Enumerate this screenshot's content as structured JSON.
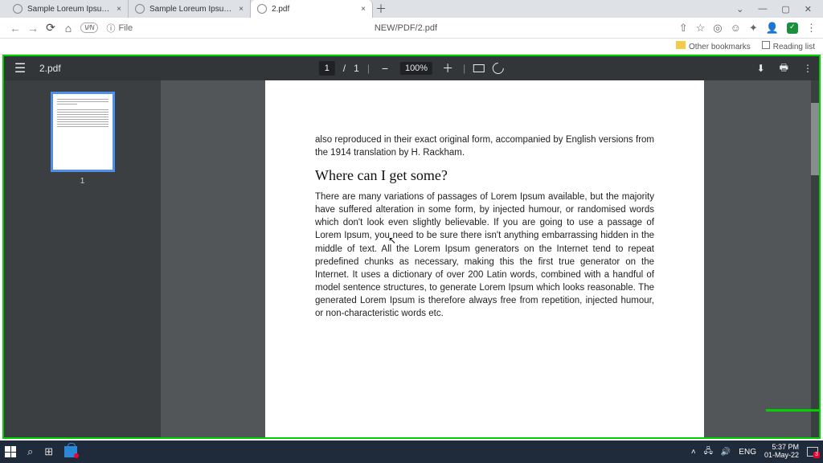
{
  "browser": {
    "tabs": [
      {
        "title": "Sample Loreum Ipsum.pdf",
        "active": false
      },
      {
        "title": "Sample Loreum Ipsum.pdf",
        "active": false
      },
      {
        "title": "2.pdf",
        "active": true
      }
    ],
    "new_tab": "＋",
    "window": {
      "min": "—",
      "max": "▢",
      "close": "✕",
      "down": "⌄"
    },
    "nav": {
      "back": "←",
      "forward": "→",
      "reload": "⟳",
      "home": "⌂"
    },
    "vpn": "V⁄N",
    "url_proto_icon": "ⓘ",
    "url_left": "File",
    "url_center": "NEW/PDF/2.pdf",
    "icons": {
      "share": "⇧",
      "star": "☆",
      "g": "◎",
      "smile": "☺",
      "puzzle": "✦",
      "user": "👤",
      "menu": "⋮"
    }
  },
  "bookmarks": {
    "other": "Other bookmarks",
    "reading": "Reading list"
  },
  "viewer": {
    "menu": "☰",
    "title": "2.pdf",
    "page_current": "1",
    "page_sep": "/",
    "page_total": "1",
    "zoom_minus": "−",
    "zoom": "100%",
    "zoom_plus": "＋",
    "download": "⬇",
    "print": "🖶",
    "more": "⋮",
    "thumb_label": "1"
  },
  "document": {
    "lead": "also reproduced in their exact original form, accompanied by English versions from the 1914 translation by H. Rackham.",
    "heading": "Where can I get some?",
    "body": "There are many variations of passages of Lorem Ipsum available, but the majority have suffered alteration in some form, by injected humour, or randomised words which don't look even slightly believable. If you are going to use a passage of Lorem Ipsum, you need to be sure there isn't anything embarrassing hidden in the middle of text. All the Lorem Ipsum generators on the Internet tend to repeat predefined chunks as necessary, making this the first true generator on the Internet. It uses a dictionary of over 200 Latin words, combined with a handful of model sentence structures, to generate Lorem Ipsum which looks reasonable. The generated Lorem Ipsum is therefore always free from repetition, injected humour, or non-characteristic words etc."
  },
  "taskbar": {
    "tray": {
      "up": "˄",
      "net": "🖧",
      "sound": "🔊",
      "lang": "ENG"
    },
    "time": "5:37 PM",
    "date": "01-May-22",
    "notif_count": "3"
  }
}
